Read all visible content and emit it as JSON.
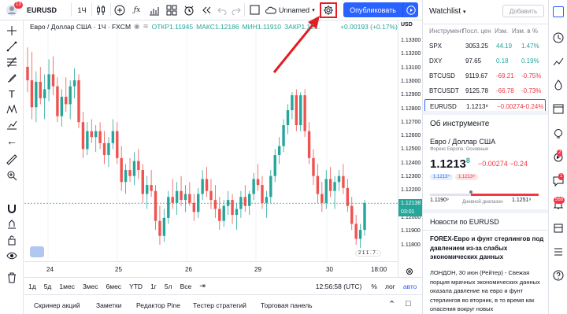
{
  "colors": {
    "accent": "#2962ff",
    "up": "#26a69a",
    "down": "#ef5350",
    "callout": "#e51c23"
  },
  "topbar": {
    "symbol": "EURUSD",
    "interval": "1Ч",
    "layout_name": "Unnamed",
    "publish_label": "Опубликовать",
    "notif_count": "13"
  },
  "legend": {
    "title": "Евро / Доллар США · 1Ч · FXCM",
    "open": "ОТКР1.11945",
    "high": "МАКС1.12186",
    "low": "МИН1.11910",
    "close": "ЗАКР1.12...",
    "change": "+0.00193 (+0.17%)"
  },
  "axis": {
    "currency": "USD",
    "prices": [
      "1.13300",
      "1.13200",
      "1.13100",
      "1.13000",
      "1.12900",
      "1.12800",
      "1.12700",
      "1.12600",
      "1.12500",
      "1.12400",
      "1.12300",
      "1.12200",
      "1.12100",
      "1.12000",
      "1.11900",
      "1.11800"
    ],
    "current": "1.12138",
    "countdown": "03:01",
    "x_labels": [
      "24",
      "25",
      "26",
      "29",
      "30",
      "18:00"
    ]
  },
  "rangebar": {
    "ranges": [
      "1д",
      "5д",
      "1мес",
      "3мес",
      "6мес",
      "YTD",
      "1г",
      "5л",
      "Все"
    ],
    "time": "12:56:58 (UTC)",
    "pct": "%",
    "log": "лог",
    "auto": "авто"
  },
  "panels": {
    "tabs": [
      "Скринер акций",
      "Заметки",
      "Редактор Pine",
      "Тестер стратегий",
      "Торговая панель"
    ]
  },
  "watchlist": {
    "title": "Watchlist",
    "add": "Добавить",
    "cols": [
      "Инструмент",
      "Посл. цен",
      "Изм.",
      "Изм. в %"
    ],
    "rows": [
      {
        "sym": "SPX",
        "last": "3053.25",
        "chg": "44.19",
        "pct": "1.47%",
        "dir": "up"
      },
      {
        "sym": "DXY",
        "last": "97.65",
        "chg": "0.18",
        "pct": "0.19%",
        "dir": "up"
      },
      {
        "sym": "BTCUSD",
        "last": "9119.67",
        "chg": "-69.21",
        "pct": "-0.75%",
        "dir": "down"
      },
      {
        "sym": "BTCUSDT",
        "last": "9125.78",
        "chg": "-66.78",
        "pct": "-0.73%",
        "dir": "down"
      },
      {
        "sym": "EURUSD",
        "last": "1.1213⁸",
        "chg": "−0.00274",
        "pct": "−0.24%",
        "dir": "down"
      }
    ]
  },
  "about": {
    "title": "Об инструменте",
    "name": "Евро / Доллар США",
    "sub": "Форекс Европа: Основные",
    "price_main": "1.1213",
    "price_sup": "8",
    "change": "−0.00274 −0.24",
    "bid": "1.1213⁴",
    "ask": "1.1213⁸",
    "low": "1.1190⁹",
    "high": "1.1251⁹",
    "range_label": "Дневной диапазон"
  },
  "news": {
    "title": "Новости по EURUSD",
    "headline": "FOREX-Евро и фунт стерлингов под давлением из-за слабых экономических данных",
    "body": "ЛОНДОН, 30 июн (Рейтер) - Свежая порция мрачных экономических данных оказала давление на евро и фунт стерлингов во вторник, в то время как опасения вокруг новых"
  },
  "sidebar_badges": {
    "alerts": "2",
    "chat": "1",
    "notifications": "568"
  },
  "chart_data": {
    "type": "candlestick",
    "ylim": [
      1.1175,
      1.1336
    ],
    "candles": [
      [
        1.1305,
        1.1318,
        1.1288,
        1.1296
      ],
      [
        1.1296,
        1.1315,
        1.127,
        1.1278
      ],
      [
        1.1278,
        1.1302,
        1.1268,
        1.1295
      ],
      [
        1.1295,
        1.1305,
        1.128,
        1.1284
      ],
      [
        1.1284,
        1.13,
        1.127,
        1.129
      ],
      [
        1.129,
        1.131,
        1.1282,
        1.13
      ],
      [
        1.13,
        1.1312,
        1.1286,
        1.1292
      ],
      [
        1.1292,
        1.1298,
        1.1268,
        1.1272
      ],
      [
        1.1272,
        1.129,
        1.1265,
        1.1285
      ],
      [
        1.1285,
        1.1298,
        1.1275,
        1.128
      ],
      [
        1.128,
        1.1296,
        1.127,
        1.1292
      ],
      [
        1.1292,
        1.1304,
        1.1284,
        1.1296
      ],
      [
        1.1296,
        1.13,
        1.1264,
        1.1268
      ],
      [
        1.1268,
        1.1275,
        1.1244,
        1.125
      ],
      [
        1.125,
        1.1268,
        1.1246,
        1.1262
      ],
      [
        1.1262,
        1.127,
        1.1254,
        1.1258
      ],
      [
        1.1258,
        1.1266,
        1.1248,
        1.1262
      ],
      [
        1.1262,
        1.1268,
        1.125,
        1.1254
      ],
      [
        1.1254,
        1.1262,
        1.124,
        1.1246
      ],
      [
        1.1246,
        1.1258,
        1.1238,
        1.1254
      ],
      [
        1.1254,
        1.127,
        1.125,
        1.1262
      ],
      [
        1.1262,
        1.1268,
        1.124,
        1.1244
      ],
      [
        1.1244,
        1.1252,
        1.1222,
        1.1228
      ],
      [
        1.1228,
        1.124,
        1.122,
        1.1236
      ],
      [
        1.1236,
        1.1244,
        1.1228,
        1.1232
      ],
      [
        1.1232,
        1.1248,
        1.1226,
        1.1242
      ],
      [
        1.1242,
        1.125,
        1.123,
        1.1236
      ],
      [
        1.1236,
        1.124,
        1.1214,
        1.122
      ],
      [
        1.122,
        1.1232,
        1.121,
        1.1226
      ],
      [
        1.1226,
        1.1236,
        1.1218,
        1.1222
      ],
      [
        1.1222,
        1.1226,
        1.1196,
        1.1202
      ],
      [
        1.1202,
        1.1212,
        1.1186,
        1.1192
      ],
      [
        1.1192,
        1.121,
        1.1188,
        1.1204
      ],
      [
        1.1204,
        1.1222,
        1.12,
        1.1218
      ],
      [
        1.1218,
        1.123,
        1.121,
        1.1214
      ],
      [
        1.1214,
        1.1228,
        1.1206,
        1.1222
      ],
      [
        1.1222,
        1.1232,
        1.1212,
        1.1216
      ],
      [
        1.1216,
        1.1226,
        1.1208,
        1.122
      ],
      [
        1.122,
        1.1228,
        1.1212,
        1.1214
      ],
      [
        1.1214,
        1.122,
        1.1202,
        1.1208
      ],
      [
        1.1208,
        1.1224,
        1.1204,
        1.122
      ],
      [
        1.122,
        1.1236,
        1.1216,
        1.123
      ],
      [
        1.123,
        1.1238,
        1.1218,
        1.1222
      ],
      [
        1.1222,
        1.123,
        1.121,
        1.1216
      ],
      [
        1.1216,
        1.1226,
        1.1204,
        1.121
      ],
      [
        1.121,
        1.1218,
        1.1196,
        1.1202
      ],
      [
        1.1202,
        1.1216,
        1.1198,
        1.1212
      ],
      [
        1.1212,
        1.1222,
        1.1206,
        1.1216
      ],
      [
        1.1216,
        1.122,
        1.12,
        1.1206
      ],
      [
        1.1206,
        1.1214,
        1.1196,
        1.121
      ],
      [
        1.121,
        1.1222,
        1.1204,
        1.1218
      ],
      [
        1.1218,
        1.1226,
        1.1208,
        1.1212
      ],
      [
        1.1212,
        1.1222,
        1.1206,
        1.122
      ],
      [
        1.122,
        1.1234,
        1.1216,
        1.123
      ],
      [
        1.123,
        1.124,
        1.1222,
        1.1226
      ],
      [
        1.1226,
        1.1232,
        1.121,
        1.1214
      ],
      [
        1.1214,
        1.1222,
        1.1204,
        1.1218
      ],
      [
        1.1218,
        1.1236,
        1.1214,
        1.1232
      ],
      [
        1.1232,
        1.125,
        1.1228,
        1.1246
      ],
      [
        1.1246,
        1.1258,
        1.124,
        1.1252
      ],
      [
        1.1252,
        1.127,
        1.1248,
        1.1266
      ],
      [
        1.1266,
        1.128,
        1.126,
        1.1276
      ],
      [
        1.1276,
        1.1288,
        1.127,
        1.1286
      ],
      [
        1.1286,
        1.129,
        1.1262,
        1.1266
      ],
      [
        1.1266,
        1.1288,
        1.1262,
        1.1286
      ],
      [
        1.1286,
        1.129,
        1.1258,
        1.1262
      ],
      [
        1.1262,
        1.1268,
        1.124,
        1.1244
      ],
      [
        1.1244,
        1.125,
        1.1226,
        1.1232
      ],
      [
        1.1232,
        1.124,
        1.1214,
        1.122
      ],
      [
        1.122,
        1.1228,
        1.1208,
        1.1214
      ],
      [
        1.1214,
        1.1236,
        1.121,
        1.123
      ],
      [
        1.123,
        1.1238,
        1.1218,
        1.1222
      ],
      [
        1.1222,
        1.1232,
        1.121,
        1.1228
      ],
      [
        1.1228,
        1.1236,
        1.1222,
        1.1232
      ],
      [
        1.1232,
        1.124,
        1.122,
        1.1224
      ],
      [
        1.1224,
        1.123,
        1.1208,
        1.1212
      ],
      [
        1.1212,
        1.1218,
        1.1196,
        1.12
      ],
      [
        1.12,
        1.1206,
        1.1186,
        1.119
      ],
      [
        1.119,
        1.12,
        1.1184,
        1.1196
      ],
      [
        1.1196,
        1.1216,
        1.1192,
        1.1214
      ]
    ]
  }
}
